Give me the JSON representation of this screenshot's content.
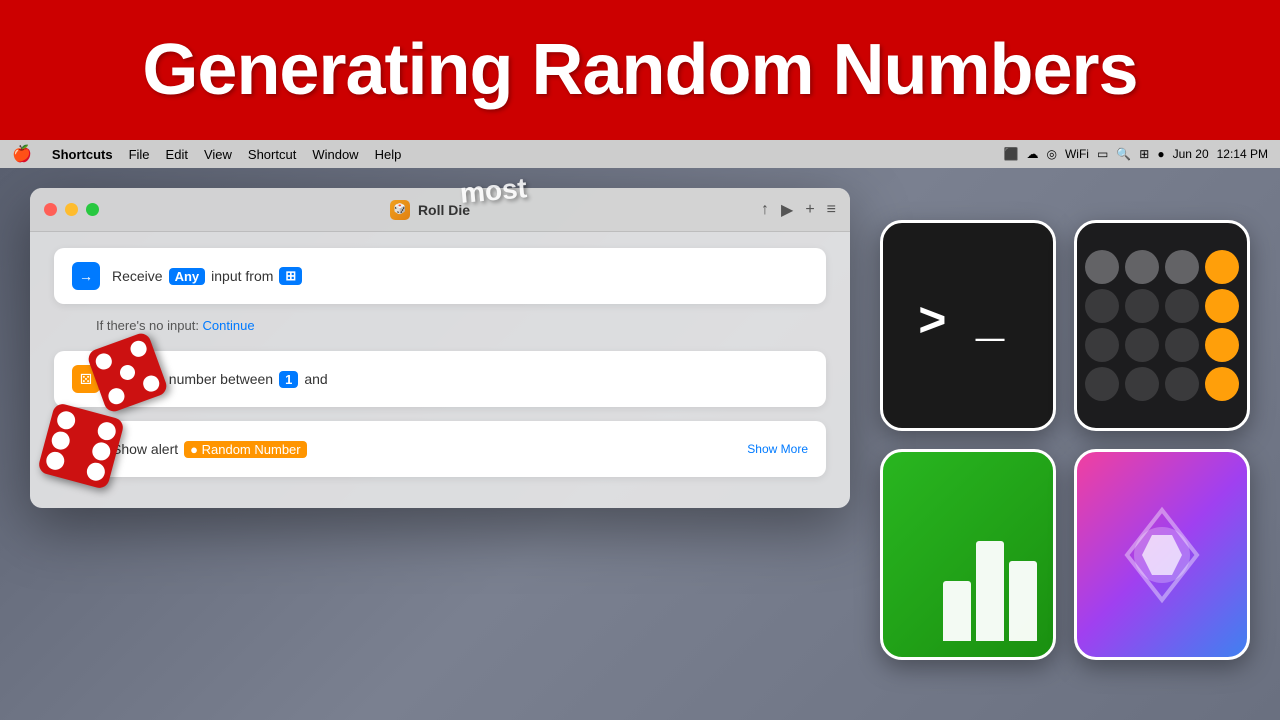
{
  "title_banner": {
    "text": "Generating Random Numbers"
  },
  "menu_bar": {
    "apple": "🍎",
    "items": [
      "Shortcuts",
      "File",
      "Edit",
      "View",
      "Shortcut",
      "Window",
      "Help"
    ],
    "right": {
      "date": "Jun 20",
      "time": "12:14 PM"
    }
  },
  "shortcuts_window": {
    "title": "Roll Die",
    "traffic_lights": {
      "red": "close",
      "yellow": "minimize",
      "green": "maximize"
    },
    "actions": [
      {
        "id": "receive",
        "icon": "→□",
        "text_parts": [
          "Receive",
          "Any",
          "input from"
        ],
        "tag": "Any",
        "type": "blue"
      },
      {
        "id": "no_input",
        "label": "If there's no input:",
        "link": "Continue"
      },
      {
        "id": "random",
        "icon": "⚄",
        "text": "Random number between",
        "num1": "1",
        "text2": "and",
        "type": "orange"
      },
      {
        "id": "alert",
        "icon": "□",
        "text": "Show alert",
        "tag": "Random Number",
        "show_more": "Show More",
        "type": "purple"
      }
    ]
  },
  "app_icons": [
    {
      "id": "terminal",
      "name": "Terminal",
      "prompt": ">_"
    },
    {
      "id": "calculator",
      "name": "Calculator"
    },
    {
      "id": "numbers",
      "name": "Numbers"
    },
    {
      "id": "shortcuts",
      "name": "Shortcuts"
    }
  ],
  "most_logo": "most",
  "dice": {
    "die1_label": "dice-1",
    "die2_label": "dice-2"
  }
}
